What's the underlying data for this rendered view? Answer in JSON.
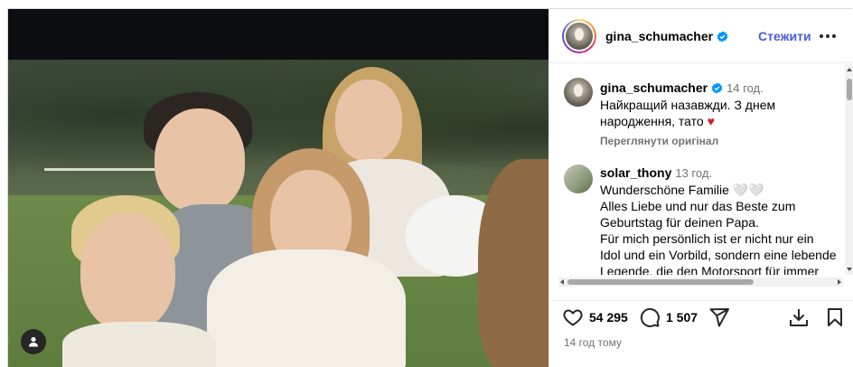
{
  "post": {
    "username": "gina_schumacher",
    "follow_label": "Стежити",
    "more_icon": "more-options-icon",
    "likes": "54 295",
    "comments_count": "1 507",
    "timestamp": "14 год тому"
  },
  "caption": {
    "username": "gina_schumacher",
    "time": "14 год.",
    "text": "Найкращий назавжди. З днем народження, тато",
    "heart": "♥",
    "see_original": "Переглянути оригінал"
  },
  "comments": [
    {
      "username": "solar_thony",
      "time": "13 год.",
      "lines": [
        "Wunderschöne Familie 🤍🤍",
        "Alles Liebe und nur das Beste zum Geburtstag für deinen Papa.",
        "Für mich persönlich ist er nicht nur ein Idol und ein Vorbild, sondern eine lebende Legende, die den Motorsport für immer geprägt hat"
      ]
    }
  ],
  "colors": {
    "follow": "#4a5cd6",
    "verified": "#0095f6",
    "heart": "#d0202f",
    "muted": "#737373"
  },
  "icons": {
    "like": "heart-outline-icon",
    "comment": "comment-bubble-icon",
    "share": "paper-plane-icon",
    "download": "download-icon",
    "save": "bookmark-icon",
    "tag": "user-tag-icon"
  }
}
